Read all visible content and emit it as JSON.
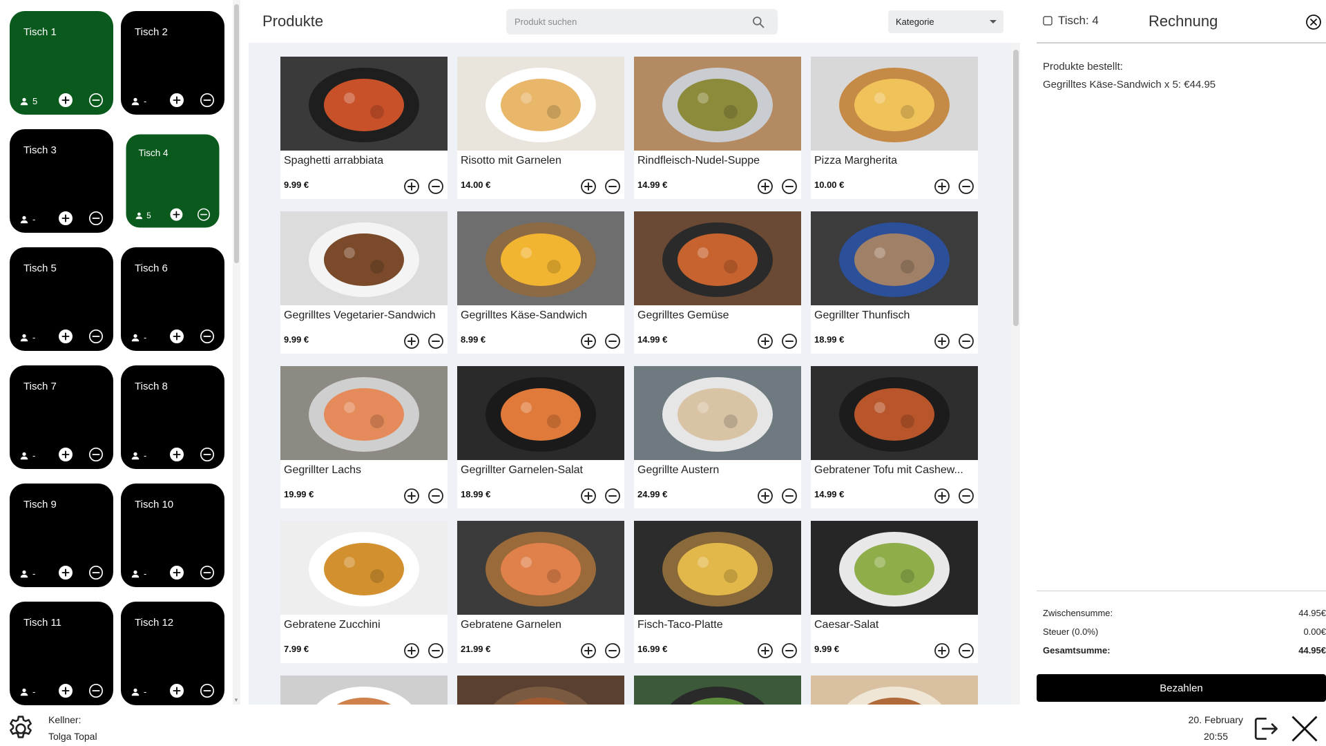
{
  "tables": [
    {
      "name": "Tisch 1",
      "guests": "5",
      "occupied": true,
      "selected": false
    },
    {
      "name": "Tisch 2",
      "guests": "-",
      "occupied": false,
      "selected": false
    },
    {
      "name": "Tisch 3",
      "guests": "-",
      "occupied": false,
      "selected": false
    },
    {
      "name": "Tisch 4",
      "guests": "5",
      "occupied": true,
      "selected": true
    },
    {
      "name": "Tisch 5",
      "guests": "-",
      "occupied": false,
      "selected": false
    },
    {
      "name": "Tisch 6",
      "guests": "-",
      "occupied": false,
      "selected": false
    },
    {
      "name": "Tisch 7",
      "guests": "-",
      "occupied": false,
      "selected": false
    },
    {
      "name": "Tisch 8",
      "guests": "-",
      "occupied": false,
      "selected": false
    },
    {
      "name": "Tisch 9",
      "guests": "-",
      "occupied": false,
      "selected": false
    },
    {
      "name": "Tisch 10",
      "guests": "-",
      "occupied": false,
      "selected": false
    },
    {
      "name": "Tisch 11",
      "guests": "-",
      "occupied": false,
      "selected": false
    },
    {
      "name": "Tisch 12",
      "guests": "-",
      "occupied": false,
      "selected": false
    }
  ],
  "footer": {
    "waiter_label": "Kellner:",
    "waiter_name": "Tolga Topal",
    "date": "20. February",
    "time": "20:55"
  },
  "products_header": {
    "title": "Produkte",
    "search_placeholder": "Produkt suchen",
    "category_label": "Kategorie"
  },
  "products": [
    {
      "name": "Spaghetti arrabbiata",
      "price": "9.99 €",
      "image": {
        "bg": "#3a3a3a",
        "plate": "#1e1e1e",
        "food": "#c8512a"
      }
    },
    {
      "name": "Risotto mit Garnelen",
      "price": "14.00 €",
      "image": {
        "bg": "#e9e4dc",
        "plate": "#ffffff",
        "food": "#e8b76a"
      }
    },
    {
      "name": "Rindfleisch-Nudel-Suppe",
      "price": "14.99 €",
      "image": {
        "bg": "#b48a62",
        "plate": "#c9ccd1",
        "food": "#8c8b3c"
      }
    },
    {
      "name": "Pizza Margherita",
      "price": "10.00 €",
      "image": {
        "bg": "#d8d8d8",
        "plate": "#c58a46",
        "food": "#f0c25a"
      }
    },
    {
      "name": "Gegrilltes Vegetarier-Sandwich",
      "price": "9.99 €",
      "image": {
        "bg": "#dcdcdc",
        "plate": "#f4f4f4",
        "food": "#7a4a2a"
      }
    },
    {
      "name": "Gegrilltes Käse-Sandwich",
      "price": "8.99 €",
      "image": {
        "bg": "#6e6e6e",
        "plate": "#8b6a44",
        "food": "#f2b532"
      }
    },
    {
      "name": "Gegrilltes Gemüse",
      "price": "14.99 €",
      "image": {
        "bg": "#6a4a35",
        "plate": "#2a2a2a",
        "food": "#c7632e"
      }
    },
    {
      "name": "Gegrillter Thunfisch",
      "price": "18.99 €",
      "image": {
        "bg": "#3c3c3c",
        "plate": "#2c4f9a",
        "food": "#a08066"
      }
    },
    {
      "name": "Gegrillter Lachs",
      "price": "19.99 €",
      "image": {
        "bg": "#8d8a84",
        "plate": "#cfcfcf",
        "food": "#e58a5a"
      }
    },
    {
      "name": "Gegrillter Garnelen-Salat",
      "price": "18.99 €",
      "image": {
        "bg": "#2a2a2a",
        "plate": "#1a1a1a",
        "food": "#e07a3a"
      }
    },
    {
      "name": "Gegrillte Austern",
      "price": "24.99 €",
      "image": {
        "bg": "#6f7a80",
        "plate": "#e6e6e6",
        "food": "#d9c3a5"
      }
    },
    {
      "name": "Gebratener Tofu mit Cashew...",
      "price": "14.99 €",
      "image": {
        "bg": "#2e2e2e",
        "plate": "#1c1c1c",
        "food": "#b8552a"
      }
    },
    {
      "name": "Gebratene Zucchini",
      "price": "7.99 €",
      "image": {
        "bg": "#eeeeee",
        "plate": "#ffffff",
        "food": "#d2912e"
      }
    },
    {
      "name": "Gebratene Garnelen",
      "price": "21.99 €",
      "image": {
        "bg": "#3b3b3b",
        "plate": "#9a6a3a",
        "food": "#e0804a"
      }
    },
    {
      "name": "Fisch-Taco-Platte",
      "price": "16.99 €",
      "image": {
        "bg": "#2c2c2c",
        "plate": "#8a6a3a",
        "food": "#e3b84a"
      }
    },
    {
      "name": "Caesar-Salat",
      "price": "9.99 €",
      "image": {
        "bg": "#262626",
        "plate": "#e8e8e8",
        "food": "#8fae4a"
      }
    }
  ],
  "partial_products": [
    {
      "image": {
        "bg": "#cfcfcf",
        "plate": "#ffffff",
        "food": "#d0804a"
      }
    },
    {
      "image": {
        "bg": "#5a4030",
        "plate": "#7a5a40",
        "food": "#a05a30"
      }
    },
    {
      "image": {
        "bg": "#3c5a3a",
        "plate": "#2a2a2a",
        "food": "#5a8a3a"
      }
    },
    {
      "image": {
        "bg": "#d8c0a0",
        "plate": "#f0e6d6",
        "food": "#b06a3a"
      }
    }
  ],
  "bill": {
    "table_label": "Tisch: 4",
    "title": "Rechnung",
    "ordered_label": "Produkte bestellt:",
    "ordered_items": [
      "Gegrilltes Käse-Sandwich x 5: €44.95"
    ],
    "subtotal_label": "Zwischensumme:",
    "subtotal_value": "44.95€",
    "tax_label": "Steuer (0.0%)",
    "tax_value": "0.00€",
    "total_label": "Gesamtsumme:",
    "total_value": "44.95€",
    "pay_label": "Bezahlen"
  },
  "colors": {
    "occupied_table": "#0b5a1d",
    "free_table": "#000000",
    "products_bg": "#eef1f6",
    "pay_button": "#000000"
  },
  "icons": {
    "settings": "gear-icon",
    "logout": "logout-icon",
    "close_app": "close-icon",
    "search": "search-icon",
    "table_indicator": "table-icon",
    "bill_close": "circle-x-icon",
    "guest": "person-icon",
    "add": "plus-circle-icon",
    "remove": "minus-circle-icon"
  }
}
